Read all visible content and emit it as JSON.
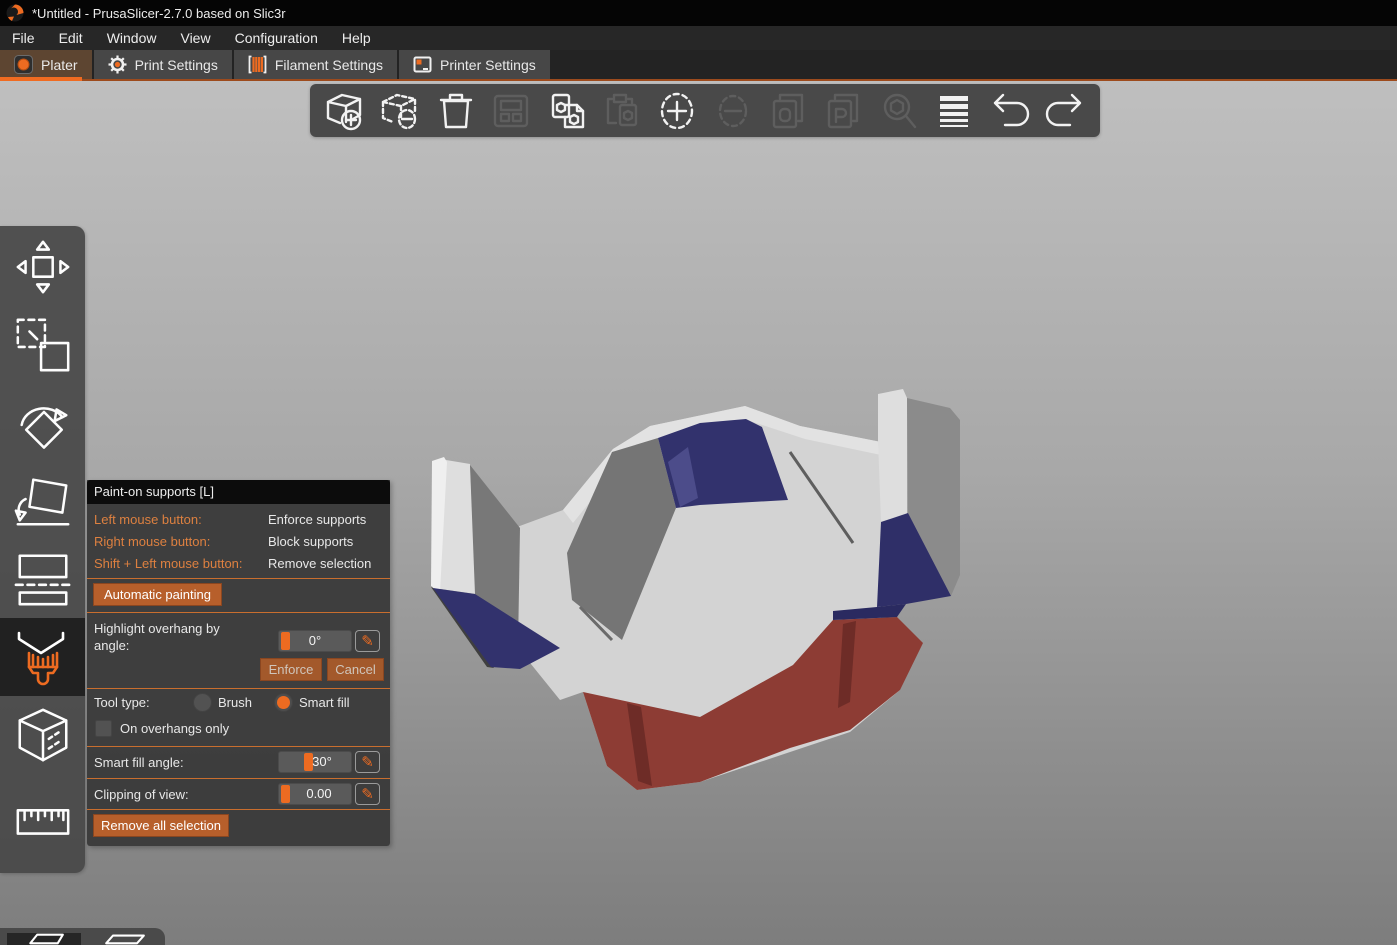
{
  "window_title": "*Untitled - PrusaSlicer-2.7.0 based on Slic3r",
  "menu": {
    "items": [
      "File",
      "Edit",
      "Window",
      "View",
      "Configuration",
      "Help"
    ]
  },
  "tabs": [
    {
      "label": "Plater",
      "active": true
    },
    {
      "label": "Print Settings",
      "active": false
    },
    {
      "label": "Filament Settings",
      "active": false
    },
    {
      "label": "Printer Settings",
      "active": false
    }
  ],
  "top_toolbar": {
    "icons": [
      {
        "name": "add-model",
        "enabled": true
      },
      {
        "name": "delete-model",
        "enabled": true
      },
      {
        "name": "delete-all",
        "enabled": true
      },
      {
        "name": "arrange",
        "enabled": false
      },
      {
        "name": "copy",
        "enabled": true
      },
      {
        "name": "paste",
        "enabled": false
      },
      {
        "name": "add-instance",
        "enabled": true
      },
      {
        "name": "remove-instance",
        "enabled": false
      },
      {
        "name": "split-to-objects",
        "enabled": false
      },
      {
        "name": "split-to-parts",
        "enabled": false
      },
      {
        "name": "search",
        "enabled": false
      },
      {
        "name": "variable-layer-height",
        "enabled": true
      },
      {
        "name": "undo",
        "enabled": true
      },
      {
        "name": "redo",
        "enabled": true
      }
    ]
  },
  "left_toolbar": {
    "icons": [
      {
        "name": "move",
        "active": false
      },
      {
        "name": "scale",
        "active": false
      },
      {
        "name": "rotate",
        "active": false
      },
      {
        "name": "place-on-face",
        "active": false
      },
      {
        "name": "cut",
        "active": false
      },
      {
        "name": "paint-on-supports",
        "active": true
      },
      {
        "name": "seam-painting",
        "active": false
      },
      {
        "name": "measure",
        "active": false
      }
    ]
  },
  "support_panel": {
    "title": "Paint-on supports [L]",
    "shortcuts": [
      {
        "key": "Left mouse button:",
        "action": "Enforce supports"
      },
      {
        "key": "Right mouse button:",
        "action": "Block supports"
      },
      {
        "key": "Shift + Left mouse button:",
        "action": "Remove selection"
      }
    ],
    "auto_paint_label": "Automatic painting",
    "highlight_label": "Highlight overhang by angle:",
    "highlight_value": "0°",
    "enforce_label": "Enforce",
    "cancel_label": "Cancel",
    "tool_type_label": "Tool type:",
    "brush_label": "Brush",
    "smart_fill_label": "Smart fill",
    "tool_type_selected": "Smart fill",
    "overhangs_only_label": "On overhangs only",
    "overhangs_only_checked": false,
    "smart_fill_angle_label": "Smart fill angle:",
    "smart_fill_angle_value": "30°",
    "clipping_label": "Clipping of view:",
    "clipping_value": "0.00",
    "remove_all_label": "Remove all selection"
  },
  "view_toolbar": {
    "icons": [
      {
        "name": "3d-editor-view",
        "active": true
      },
      {
        "name": "preview",
        "active": false
      }
    ]
  },
  "colors": {
    "accent": "#ED6B21",
    "panel_button": "#b75f2b",
    "paint_blue": "#32326d",
    "paint_red": "#8d3c34",
    "model_white": "#d3d3d3",
    "viewport_top": "#bfbfbf",
    "viewport_bottom": "#7d7d7d"
  }
}
